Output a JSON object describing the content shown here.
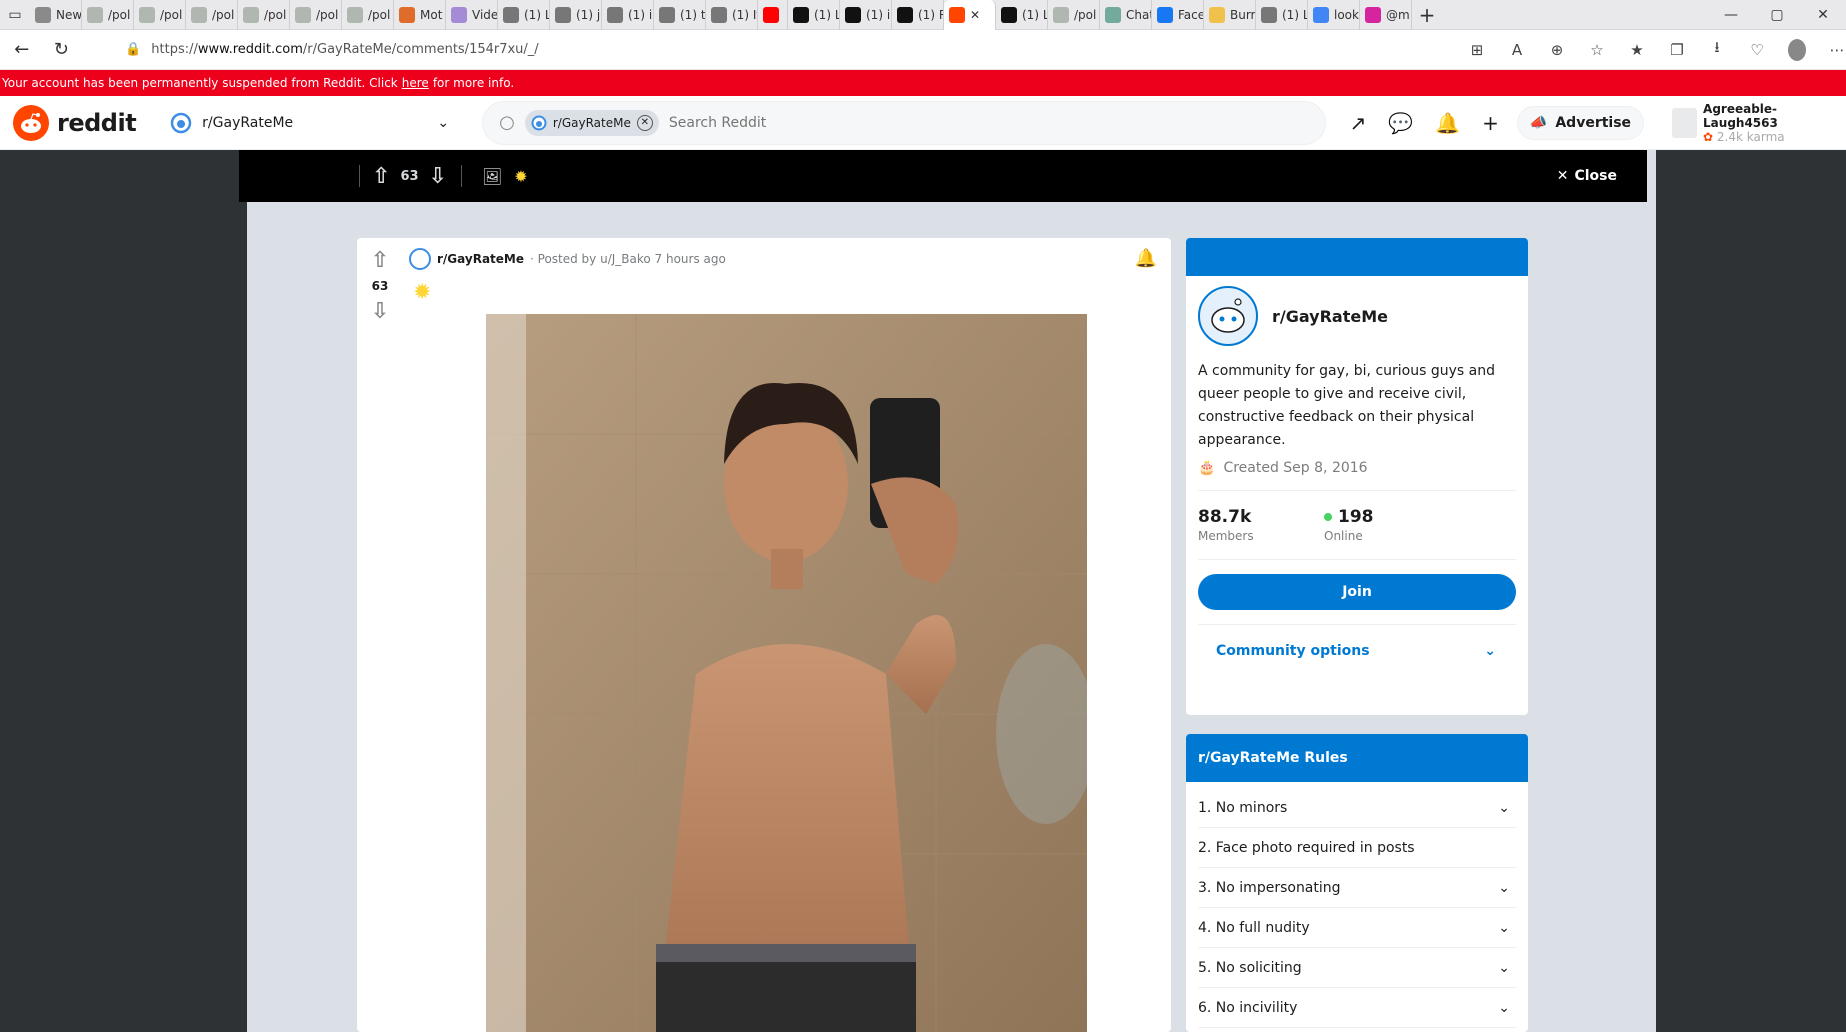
{
  "browser": {
    "tabs": [
      {
        "label": "New",
        "icon": "page-icon",
        "color": "#8a8a8a"
      },
      {
        "label": "/pol",
        "icon": "4chan-icon",
        "color": "#b0b7b0"
      },
      {
        "label": "/pol",
        "icon": "4chan-icon",
        "color": "#b0b7b0"
      },
      {
        "label": "/pol",
        "icon": "4chan-icon",
        "color": "#b0b7b0"
      },
      {
        "label": "/pol",
        "icon": "4chan-icon",
        "color": "#b0b7b0"
      },
      {
        "label": "/pol",
        "icon": "4chan-icon",
        "color": "#b0b7b0"
      },
      {
        "label": "/pol",
        "icon": "4chan-icon",
        "color": "#b0b7b0"
      },
      {
        "label": "Mot",
        "icon": "jp-icon",
        "color": "#e06c2b"
      },
      {
        "label": "Vide",
        "icon": "video-icon",
        "color": "#a58ad6"
      },
      {
        "label": "(1) L",
        "icon": "tab-icon",
        "color": "#777"
      },
      {
        "label": "(1) ju",
        "icon": "tab-icon",
        "color": "#777"
      },
      {
        "label": "(1) i",
        "icon": "tab-icon",
        "color": "#777"
      },
      {
        "label": "(1) t",
        "icon": "tab-icon",
        "color": "#777"
      },
      {
        "label": "(1) It",
        "icon": "tab-icon",
        "color": "#777"
      },
      {
        "label": "",
        "icon": "youtube-icon",
        "color": "#ff0000"
      },
      {
        "label": "(1) L",
        "icon": "tab-icon",
        "color": "#111"
      },
      {
        "label": "(1) i",
        "icon": "tab-icon",
        "color": "#111"
      },
      {
        "label": "(1) R",
        "icon": "tab-icon",
        "color": "#111"
      },
      {
        "label": "",
        "icon": "reddit-icon",
        "color": "#ff4500",
        "active": true
      },
      {
        "label": "(1) L",
        "icon": "tab-icon",
        "color": "#111"
      },
      {
        "label": "/pol",
        "icon": "4chan-icon",
        "color": "#b0b7b0"
      },
      {
        "label": "Chat",
        "icon": "chat-icon",
        "color": "#74aa9c"
      },
      {
        "label": "Face",
        "icon": "facebook-icon",
        "color": "#1877f2"
      },
      {
        "label": "Burr",
        "icon": "burr-icon",
        "color": "#f0c24b"
      },
      {
        "label": "(1) L",
        "icon": "tab-icon",
        "color": "#777"
      },
      {
        "label": "look",
        "icon": "google-icon",
        "color": "#4285f4"
      },
      {
        "label": "@m",
        "icon": "instagram-icon",
        "color": "#d6249f"
      }
    ],
    "url_prefix": "https://",
    "url_host": "www.reddit.com",
    "url_path": "/r/GayRateMe/comments/154r7xu/_/"
  },
  "banner": {
    "text_before": "Your account has been permanently suspended from Reddit. Click",
    "link": "here",
    "text_after": "for more info."
  },
  "header": {
    "logo_text": "reddit",
    "community": "r/GayRateMe",
    "search_chip": "r/GayRateMe",
    "search_placeholder": "Search Reddit",
    "advertise": "Advertise",
    "username": "Agreeable-Laugh4563",
    "karma": "2.4k karma"
  },
  "postbar": {
    "score": "63",
    "close_label": "Close"
  },
  "post": {
    "subreddit": "r/GayRateMe",
    "posted_by": "· Posted by u/J_Bako 7 hours ago",
    "score": "63"
  },
  "sidebar": {
    "community": "r/GayRateMe",
    "description": "A community for gay, bi, curious guys and queer people to give and receive civil, constructive feedback on their physical appearance.",
    "created": "Created Sep 8, 2016",
    "members": "88.7k",
    "members_label": "Members",
    "online": "198",
    "online_label": "Online",
    "join": "Join",
    "community_options": "Community options"
  },
  "rules": {
    "title": "r/GayRateMe Rules",
    "items": [
      {
        "label": "1. No minors",
        "expandable": true
      },
      {
        "label": "2. Face photo required in posts",
        "expandable": false
      },
      {
        "label": "3. No impersonating",
        "expandable": true
      },
      {
        "label": "4. No full nudity",
        "expandable": true
      },
      {
        "label": "5. No soliciting",
        "expandable": true
      },
      {
        "label": "6. No incivility",
        "expandable": true
      }
    ]
  },
  "colors": {
    "banner": "#ed001c",
    "reddit_orange": "#ff4500",
    "accent_blue": "#0079d3",
    "online_green": "#46d160",
    "page_bg": "#dae0e6"
  }
}
